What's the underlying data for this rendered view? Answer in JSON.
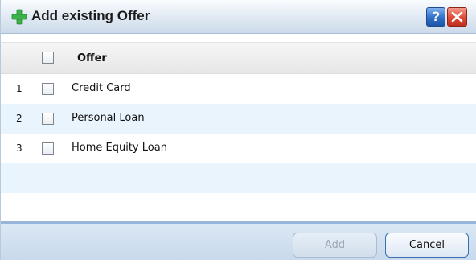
{
  "dialog": {
    "title": "Add existing Offer",
    "help_label": "?",
    "accent_color": "#3bb34a"
  },
  "table": {
    "columns": [
      {
        "label": "Offer"
      }
    ],
    "rows": [
      {
        "index": "1",
        "label": "Credit Card",
        "checked": false
      },
      {
        "index": "2",
        "label": "Personal Loan",
        "checked": false
      },
      {
        "index": "3",
        "label": "Home Equity Loan",
        "checked": false
      }
    ],
    "select_all_checked": false
  },
  "footer": {
    "add_label": "Add",
    "add_enabled": false,
    "cancel_label": "Cancel"
  },
  "icons": {
    "title": "plus-icon",
    "help": "help-icon",
    "close": "close-icon"
  }
}
